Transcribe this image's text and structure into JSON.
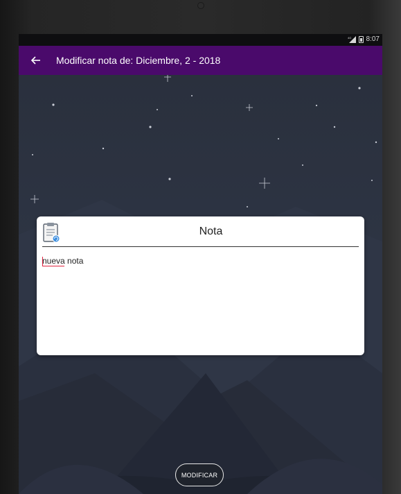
{
  "status_bar": {
    "network": "4G",
    "time": "8:07"
  },
  "app_bar": {
    "title": "Modificar nota de: Diciembre, 2 - 2018",
    "back_icon": "arrow-back-icon"
  },
  "dialog": {
    "icon": "clipboard-note-icon",
    "title": "Nota",
    "note_text": "nueva nota"
  },
  "actions": {
    "modify_label": "MODIFICAR"
  },
  "colors": {
    "app_bar": "#4a0a6b",
    "background": "#2b3140",
    "spell_underline": "#e0223f"
  }
}
